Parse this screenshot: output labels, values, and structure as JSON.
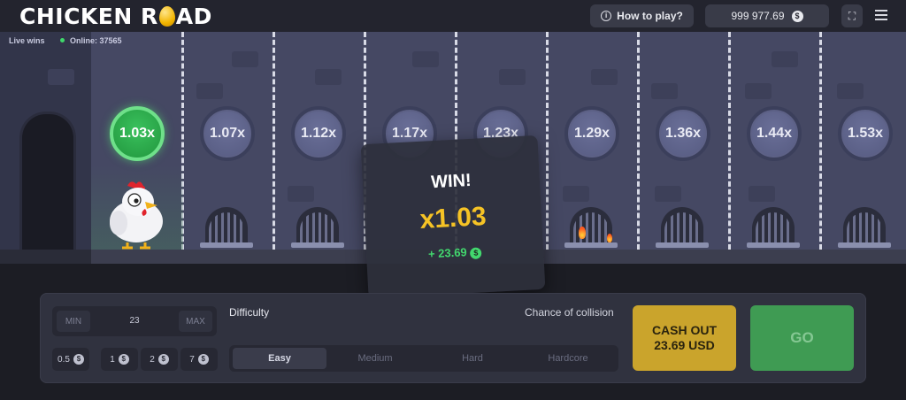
{
  "header": {
    "logo_left": "CHICKEN R",
    "logo_right": "AD",
    "howto_label": "How to play?",
    "balance": "999 977.69",
    "currency_symbol": "$"
  },
  "status": {
    "live_wins": "Live wins",
    "online": "Online: 37565"
  },
  "lanes": [
    {
      "multiplier": "1.03x",
      "state": "active"
    },
    {
      "multiplier": "1.07x"
    },
    {
      "multiplier": "1.12x"
    },
    {
      "multiplier": "1.17x"
    },
    {
      "multiplier": "1.23x"
    },
    {
      "multiplier": "1.29x"
    },
    {
      "multiplier": "1.36x"
    },
    {
      "multiplier": "1.44x"
    },
    {
      "multiplier": "1.53x"
    }
  ],
  "win_popup": {
    "title": "WIN!",
    "multiplier": "x1.03",
    "amount": "+ 23.69"
  },
  "controls": {
    "min_label": "MIN",
    "max_label": "MAX",
    "bet_value": "23",
    "quick_bets": [
      "0.5",
      "1",
      "2",
      "7"
    ],
    "difficulty_label": "Difficulty",
    "chance_label": "Chance of collision",
    "difficulties": [
      "Easy",
      "Medium",
      "Hard",
      "Hardcore"
    ],
    "selected_difficulty": "Easy",
    "cashout_line1": "CASH OUT",
    "cashout_line2": "23.69 USD",
    "go_label": "GO"
  },
  "colors": {
    "active_multiplier": "#21963d",
    "win_multiplier": "#f6c325",
    "win_amount": "#42d86e",
    "cashout": "#caa42c",
    "go": "#3f9b53"
  }
}
